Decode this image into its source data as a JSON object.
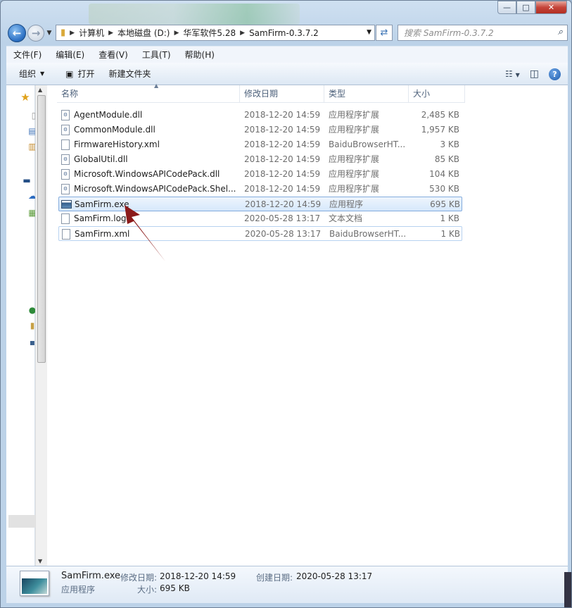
{
  "window": {
    "controls": {
      "minimize": "—",
      "maximize": "□",
      "close": "✕"
    }
  },
  "address": {
    "breadcrumbs": [
      "计算机",
      "本地磁盘 (D:)",
      "华军软件5.28",
      "SamFirm-0.3.7.2"
    ]
  },
  "search": {
    "placeholder": "搜索 SamFirm-0.3.7.2"
  },
  "menubar": [
    "文件(F)",
    "编辑(E)",
    "查看(V)",
    "工具(T)",
    "帮助(H)"
  ],
  "toolbar": {
    "organize": "组织",
    "open": "打开",
    "new_folder": "新建文件夹"
  },
  "columns": {
    "name": "名称",
    "date": "修改日期",
    "type": "类型",
    "size": "大小"
  },
  "files": [
    {
      "name": "AgentModule.dll",
      "date": "2018-12-20 14:59",
      "type": "应用程序扩展",
      "size": "2,485 KB",
      "icon": "dll-icon"
    },
    {
      "name": "CommonModule.dll",
      "date": "2018-12-20 14:59",
      "type": "应用程序扩展",
      "size": "1,957 KB",
      "icon": "dll-icon"
    },
    {
      "name": "FirmwareHistory.xml",
      "date": "2018-12-20 14:59",
      "type": "BaiduBrowserHT...",
      "size": "3 KB",
      "icon": "xml-icon"
    },
    {
      "name": "GlobalUtil.dll",
      "date": "2018-12-20 14:59",
      "type": "应用程序扩展",
      "size": "85 KB",
      "icon": "dll-icon"
    },
    {
      "name": "Microsoft.WindowsAPICodePack.dll",
      "date": "2018-12-20 14:59",
      "type": "应用程序扩展",
      "size": "104 KB",
      "icon": "dll-icon"
    },
    {
      "name": "Microsoft.WindowsAPICodePack.Shel...",
      "date": "2018-12-20 14:59",
      "type": "应用程序扩展",
      "size": "530 KB",
      "icon": "dll-icon"
    },
    {
      "name": "SamFirm.exe",
      "date": "2018-12-20 14:59",
      "type": "应用程序",
      "size": "695 KB",
      "icon": "exe-icon"
    },
    {
      "name": "SamFirm.log",
      "date": "2020-05-28 13:17",
      "type": "文本文档",
      "size": "1 KB",
      "icon": "txt-icon"
    },
    {
      "name": "SamFirm.xml",
      "date": "2020-05-28 13:17",
      "type": "BaiduBrowserHT...",
      "size": "1 KB",
      "icon": "xml-icon"
    }
  ],
  "details": {
    "filename": "SamFirm.exe",
    "filetype": "应用程序",
    "modified_label": "修改日期:",
    "modified_value": "2018-12-20 14:59",
    "created_label": "创建日期:",
    "created_value": "2020-05-28 13:17",
    "size_label": "大小:",
    "size_value": "695 KB"
  },
  "colors": {
    "selection_border": "#84acdd",
    "annotation_arrow": "#8b1a1a"
  }
}
